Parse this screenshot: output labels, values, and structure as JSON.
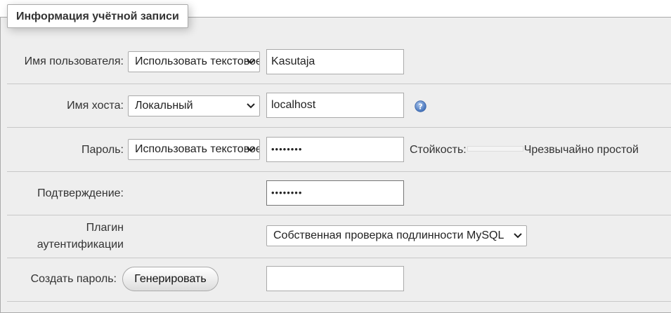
{
  "section": {
    "title": "Информация учётной записи"
  },
  "username": {
    "label": "Имя пользователя:",
    "mode": "Использовать текстовое поле",
    "value": "Kasutaja"
  },
  "hostname": {
    "label": "Имя хоста:",
    "mode": "Локальный",
    "value": "localhost",
    "help_icon": "help-question-icon"
  },
  "password": {
    "label": "Пароль:",
    "mode": "Использовать текстовое поле",
    "value": "••••••••",
    "strength_label": "Стойкость:",
    "strength_value": "Чрезвычайно простой",
    "strength_level": 0
  },
  "confirm": {
    "label": "Подтверждение:",
    "value": "••••••••"
  },
  "auth_plugin": {
    "label": "Плагин аутентификации",
    "selected": "Собственная проверка подлинности MySQL"
  },
  "generate": {
    "label": "Создать пароль:",
    "button": "Генерировать",
    "value": ""
  },
  "colors": {
    "panel_bg": "#eeeeee",
    "border": "#aaaaaa",
    "help_icon": "#5b86c7"
  }
}
